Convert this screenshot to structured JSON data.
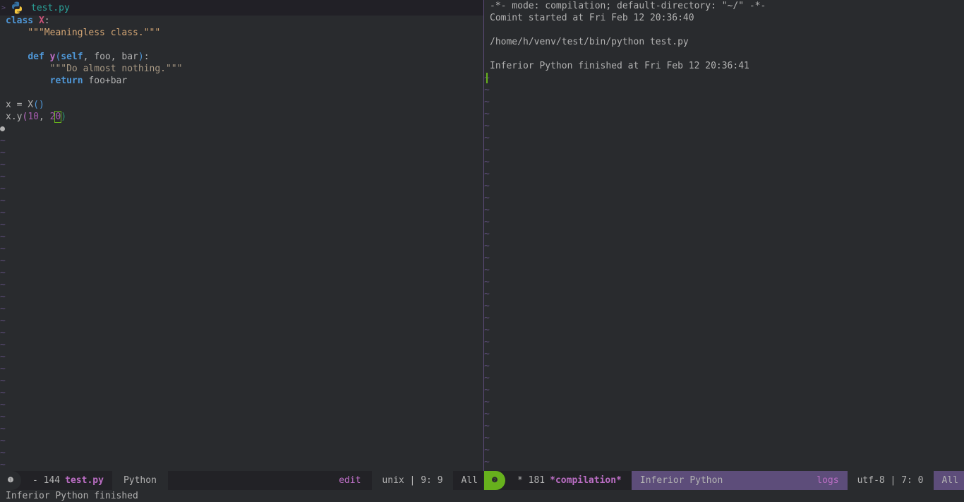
{
  "left_window": {
    "header": {
      "file_name": "test.py"
    },
    "code": {
      "l1_kw": "class",
      "l1_name": "X",
      "l1_colon": ":",
      "l2_doc": "\"\"\"Meaningless class.\"\"\"",
      "l4_kw": "def",
      "l4_fn": "y",
      "l4_open": "(",
      "l4_self": "self",
      "l4_rest": ", foo, bar",
      "l4_close": ")",
      "l4_colon": ":",
      "l5_doc": "\"\"\"Do almost nothing.\"\"\"",
      "l6_kw": "return",
      "l6_rest": " foo+bar",
      "l8_a": "x = X",
      "l8_paren": "()",
      "l9_a": "x.y",
      "l9_open": "(",
      "l9_n1": "10",
      "l9_comma": ", ",
      "l9_n2a": "2",
      "l9_n2b": "0",
      "l9_close": ")"
    },
    "tilde": "~",
    "modeline": {
      "window_number": "❶",
      "state": "- 144",
      "buffer_name": "test.py",
      "major_mode": "Python",
      "evil_state": "edit",
      "encoding_pos": "unix | 9: 9",
      "scroll": "All"
    }
  },
  "right_window": {
    "lines": [
      "-*- mode: compilation; default-directory: \"~/\" -*-",
      "Comint started at Fri Feb 12 20:36:40",
      "",
      "/home/h/venv/test/bin/python test.py",
      "",
      "Inferior Python finished at Fri Feb 12 20:36:41"
    ],
    "tilde": "~",
    "modeline": {
      "window_number": "❷",
      "state": "* 181",
      "buffer_name": "*compilation*",
      "major_mode": "Inferior Python",
      "minor": "logs",
      "encoding_pos": "utf-8 | 7: 0",
      "scroll": "All"
    }
  },
  "echo_area": {
    "message": "Inferior Python finished"
  },
  "colors": {
    "background": "#292b2e",
    "keyword": "#4f97d7",
    "function": "#bc6ec5",
    "active_accent": "#67b11d",
    "modeline_purple": "#5d4d7a"
  }
}
